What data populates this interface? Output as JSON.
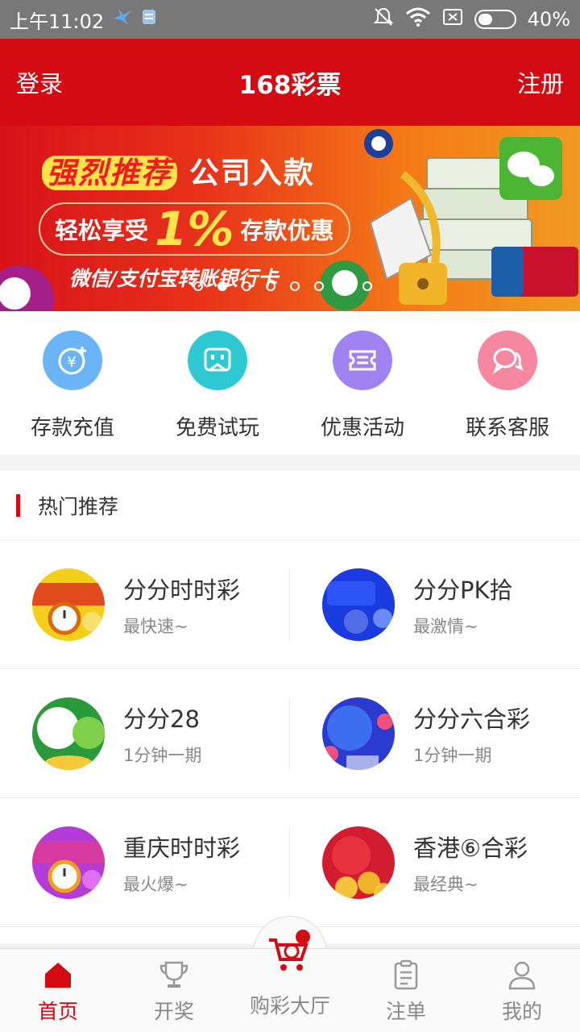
{
  "status_bar": {
    "time": "上午11:02",
    "battery": "40%",
    "battery_level": 0.4
  },
  "header": {
    "login": "登录",
    "title": "168彩票",
    "register": "注册"
  },
  "banner": {
    "line1_highlight": "强烈推荐",
    "line1_text": "公司入款",
    "line2_prefix": "轻松享受",
    "line2_pct": "1%",
    "line2_suffix": "存款优惠",
    "line3": "微信/支付宝转账银行卡",
    "slide_count": 8,
    "active_slide": 1
  },
  "quick_actions": [
    {
      "label": "存款充值",
      "icon": "deposit-icon",
      "color": "#5aa9f5"
    },
    {
      "label": "免费试玩",
      "icon": "trial-icon",
      "color": "#2dc6d0"
    },
    {
      "label": "优惠活动",
      "icon": "ticket-icon",
      "color": "#9b7ef0"
    },
    {
      "label": "联系客服",
      "icon": "chat-icon",
      "color": "#f37f9a"
    }
  ],
  "hot": {
    "title": "热门推荐",
    "games": [
      {
        "name": "分分时时彩",
        "desc": "最快速~",
        "icon": "ffssc-icon"
      },
      {
        "name": "分分PK拾",
        "desc": "最激情~",
        "icon": "ffpk10-icon"
      },
      {
        "name": "分分28",
        "desc": "1分钟一期",
        "icon": "ff28-icon"
      },
      {
        "name": "分分六合彩",
        "desc": "1分钟一期",
        "icon": "fflhc-icon"
      },
      {
        "name": "重庆时时彩",
        "desc": "最火爆~",
        "icon": "cqssc-icon"
      },
      {
        "name": "香港⑥合彩",
        "desc": "最经典~",
        "icon": "hklhc-icon"
      }
    ]
  },
  "bottom_nav": [
    {
      "label": "首页",
      "icon": "home-icon",
      "active": true
    },
    {
      "label": "开奖",
      "icon": "trophy-icon",
      "active": false
    },
    {
      "label": "购彩大厅",
      "icon": "cart-icon",
      "active": false
    },
    {
      "label": "注单",
      "icon": "clipboard-icon",
      "active": false
    },
    {
      "label": "我的",
      "icon": "user-icon",
      "active": false
    }
  ],
  "colors": {
    "brand": "#d40b12",
    "gold": "#ffe34a"
  }
}
